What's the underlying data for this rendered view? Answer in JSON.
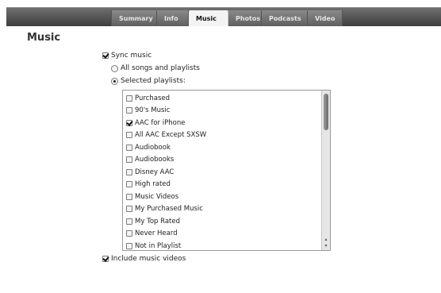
{
  "tabs": [
    {
      "label": "Summary"
    },
    {
      "label": "Info"
    },
    {
      "label": "Music"
    },
    {
      "label": "Photos"
    },
    {
      "label": "Podcasts"
    },
    {
      "label": "Video"
    }
  ],
  "active_tab": "Music",
  "section": {
    "title": "Music"
  },
  "sync": {
    "label": "Sync music",
    "checked": true
  },
  "options": {
    "all": {
      "label": "All songs and playlists",
      "selected": false
    },
    "selected": {
      "label": "Selected playlists:",
      "selected": true
    }
  },
  "playlists": [
    {
      "label": "Purchased",
      "checked": false
    },
    {
      "label": "90's Music",
      "checked": false
    },
    {
      "label": "AAC for iPhone",
      "checked": true
    },
    {
      "label": "All AAC Except SXSW",
      "checked": false
    },
    {
      "label": "Audiobook",
      "checked": false
    },
    {
      "label": "Audiobooks",
      "checked": false
    },
    {
      "label": "Disney AAC",
      "checked": false
    },
    {
      "label": "High rated",
      "checked": false
    },
    {
      "label": "Music Videos",
      "checked": false
    },
    {
      "label": "My Purchased Music",
      "checked": false
    },
    {
      "label": "My Top Rated",
      "checked": false
    },
    {
      "label": "Never Heard",
      "checked": false
    },
    {
      "label": "Not in Playlist",
      "checked": false
    }
  ],
  "include_videos": {
    "label": "Include music videos",
    "checked": true
  },
  "icons": {
    "scroll_up": "▴",
    "scroll_down": "▾"
  }
}
